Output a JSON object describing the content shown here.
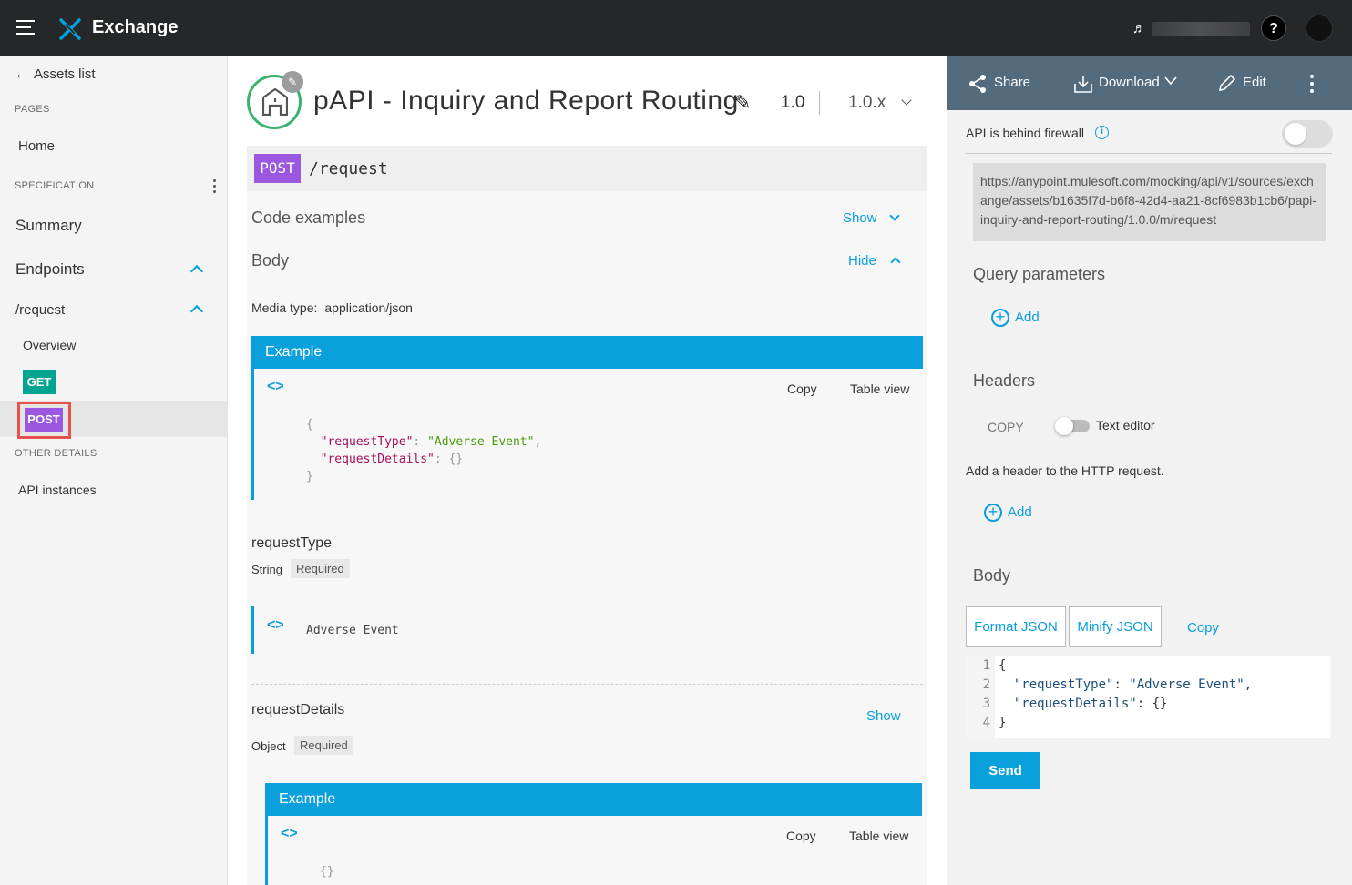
{
  "topbar": {
    "app_title": "Exchange",
    "help_label": "?"
  },
  "sidebar": {
    "back_label": "Assets list",
    "pages_section": "PAGES",
    "home": "Home",
    "spec_section": "SPECIFICATION",
    "summary": "Summary",
    "endpoints": "Endpoints",
    "resource": "/request",
    "overview": "Overview",
    "get": "GET",
    "post": "POST",
    "other_section": "OTHER DETAILS",
    "api_instances": "API instances"
  },
  "main": {
    "title": "pAPI - Inquiry and Report Routing",
    "version": "1.0",
    "version_select": "1.0.x",
    "method": "POST",
    "path": "/request",
    "code_examples": "Code examples",
    "show": "Show",
    "body": "Body",
    "hide": "Hide",
    "media_label": "Media type:",
    "media_value": "application/json",
    "example": {
      "header": "Example",
      "copy": "Copy",
      "table_view": "Table view"
    },
    "prop1": {
      "name": "requestType",
      "type": "String",
      "required": "Required",
      "example_value": "Adverse Event"
    },
    "prop2": {
      "name": "requestDetails",
      "type": "Object",
      "required": "Required",
      "show": "Show",
      "example_code": "{}"
    }
  },
  "right": {
    "share": "Share",
    "download": "Download",
    "edit": "Edit",
    "firewall_label": "API is behind firewall",
    "url": "https://anypoint.mulesoft.com/mocking/api/v1/sources/exchange/assets/b1635f7d-b6f8-42d4-aa21-8cf6983b1cb6/papi-inquiry-and-report-routing/1.0.0/m/request",
    "query_params": "Query parameters",
    "add": "Add",
    "headers": "Headers",
    "copy_upper": "COPY",
    "text_editor": "Text editor",
    "header_hint": "Add a header to the HTTP request.",
    "body": "Body",
    "format_json": "Format JSON",
    "minify_json": "Minify JSON",
    "copy": "Copy",
    "line_numbers": "1\n2\n3\n4",
    "send": "Send"
  },
  "colors": {
    "topbar": "#262728",
    "accent": "#0aa0dc",
    "post": "#9b57e0",
    "get": "#00a490",
    "toolbar": "#536b7d"
  }
}
